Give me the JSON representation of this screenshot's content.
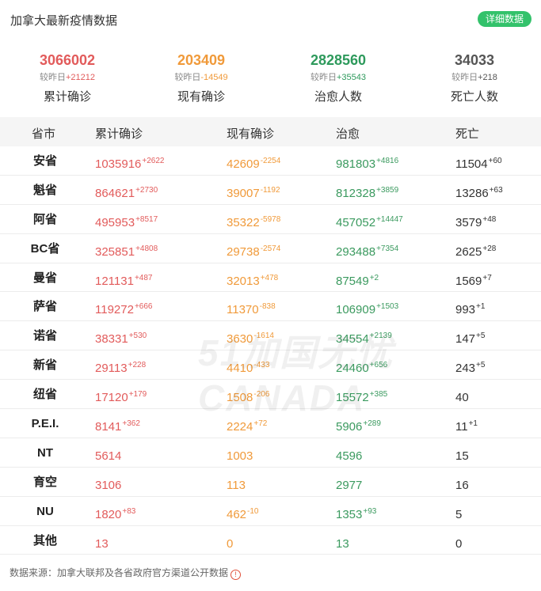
{
  "header": {
    "title": "加拿大最新疫情数据",
    "detail_button": "详细数据"
  },
  "summary": [
    {
      "value": "3066002",
      "delta_prefix": "较昨日",
      "delta": "+21212",
      "label": "累计确诊"
    },
    {
      "value": "203409",
      "delta_prefix": "较昨日",
      "delta": "-14549",
      "label": "现有确诊"
    },
    {
      "value": "2828560",
      "delta_prefix": "较昨日",
      "delta": "+35543",
      "label": "治愈人数"
    },
    {
      "value": "34033",
      "delta_prefix": "较昨日",
      "delta": "+218",
      "label": "死亡人数"
    }
  ],
  "table": {
    "headers": [
      "省市",
      "累计确诊",
      "现有确诊",
      "治愈",
      "死亡"
    ],
    "rows": [
      {
        "name": "安省",
        "cum": "1035916",
        "cum_d": "+2622",
        "cur": "42609",
        "cur_d": "-2254",
        "rec": "981803",
        "rec_d": "+4816",
        "dea": "11504",
        "dea_d": "+60"
      },
      {
        "name": "魁省",
        "cum": "864621",
        "cum_d": "+2730",
        "cur": "39007",
        "cur_d": "-1192",
        "rec": "812328",
        "rec_d": "+3859",
        "dea": "13286",
        "dea_d": "+63"
      },
      {
        "name": "阿省",
        "cum": "495953",
        "cum_d": "+8517",
        "cur": "35322",
        "cur_d": "-5978",
        "rec": "457052",
        "rec_d": "+14447",
        "dea": "3579",
        "dea_d": "+48"
      },
      {
        "name": "BC省",
        "cum": "325851",
        "cum_d": "+4808",
        "cur": "29738",
        "cur_d": "-2574",
        "rec": "293488",
        "rec_d": "+7354",
        "dea": "2625",
        "dea_d": "+28"
      },
      {
        "name": "曼省",
        "cum": "121131",
        "cum_d": "+487",
        "cur": "32013",
        "cur_d": "+478",
        "rec": "87549",
        "rec_d": "+2",
        "dea": "1569",
        "dea_d": "+7"
      },
      {
        "name": "萨省",
        "cum": "119272",
        "cum_d": "+666",
        "cur": "11370",
        "cur_d": "-838",
        "rec": "106909",
        "rec_d": "+1503",
        "dea": "993",
        "dea_d": "+1"
      },
      {
        "name": "诺省",
        "cum": "38331",
        "cum_d": "+530",
        "cur": "3630",
        "cur_d": "-1614",
        "rec": "34554",
        "rec_d": "+2139",
        "dea": "147",
        "dea_d": "+5"
      },
      {
        "name": "新省",
        "cum": "29113",
        "cum_d": "+228",
        "cur": "4410",
        "cur_d": "-433",
        "rec": "24460",
        "rec_d": "+656",
        "dea": "243",
        "dea_d": "+5"
      },
      {
        "name": "纽省",
        "cum": "17120",
        "cum_d": "+179",
        "cur": "1508",
        "cur_d": "-206",
        "rec": "15572",
        "rec_d": "+385",
        "dea": "40",
        "dea_d": ""
      },
      {
        "name": "P.E.I.",
        "cum": "8141",
        "cum_d": "+362",
        "cur": "2224",
        "cur_d": "+72",
        "rec": "5906",
        "rec_d": "+289",
        "dea": "11",
        "dea_d": "+1"
      },
      {
        "name": "NT",
        "cum": "5614",
        "cum_d": "",
        "cur": "1003",
        "cur_d": "",
        "rec": "4596",
        "rec_d": "",
        "dea": "15",
        "dea_d": ""
      },
      {
        "name": "育空",
        "cum": "3106",
        "cum_d": "",
        "cur": "113",
        "cur_d": "",
        "rec": "2977",
        "rec_d": "",
        "dea": "16",
        "dea_d": ""
      },
      {
        "name": "NU",
        "cum": "1820",
        "cum_d": "+83",
        "cur": "462",
        "cur_d": "-10",
        "rec": "1353",
        "rec_d": "+93",
        "dea": "5",
        "dea_d": ""
      },
      {
        "name": "其他",
        "cum": "13",
        "cum_d": "",
        "cur": "0",
        "cur_d": "",
        "rec": "13",
        "rec_d": "",
        "dea": "0",
        "dea_d": ""
      }
    ]
  },
  "watermark": "51加国无忧 CANADA",
  "footer": {
    "source": "数据来源：加拿大联邦及各省政府官方渠道公开数据"
  },
  "colors": {
    "accent": "#33c26b",
    "confirmed": "#e25b5b",
    "current": "#f09a3a",
    "recovered": "#2e9a5c",
    "deaths": "#555555"
  }
}
